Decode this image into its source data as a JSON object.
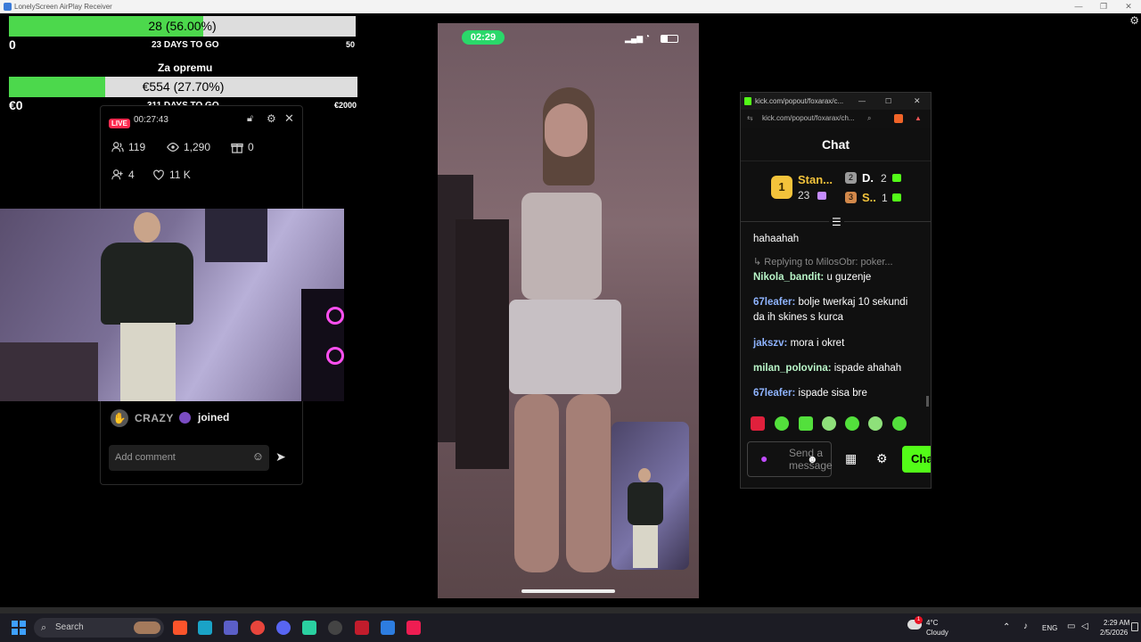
{
  "window": {
    "title": "LonelyScreen AirPlay Receiver",
    "controls": [
      "—",
      "❐",
      "✕"
    ]
  },
  "goal1": {
    "label": "28 (56.00%)",
    "percent": 56.0,
    "min": "0",
    "max": "50",
    "days": "23 DAYS TO GO"
  },
  "goal2": {
    "title": "Za opremu",
    "label": "€554 (27.70%)",
    "percent": 27.7,
    "min": "€0",
    "max": "€2000",
    "days": "311 DAYS TO GO"
  },
  "stream": {
    "live": "LIVE",
    "timer": "00:27:43",
    "viewers": "119",
    "views": "1,290",
    "gifts": "0",
    "follows": "4",
    "likes": "11 K",
    "join_user": "CRAZY",
    "join_text": "joined",
    "comment_placeholder": "Add comment"
  },
  "phone": {
    "time": "02:29"
  },
  "chat": {
    "window_title": "kick.com/popout/foxarax/c...",
    "url": "kick.com/popout/foxarax/ch...",
    "header": "Chat",
    "leaderboard": {
      "first_name": "Stan...",
      "first_count": "23",
      "second_name": "D.",
      "second_count": "2",
      "third_name": "S..",
      "third_count": "1",
      "rank1": "1",
      "rank2": "2",
      "rank3": "3"
    },
    "messages": [
      {
        "user": "",
        "text": "hahaahah",
        "color": "#ffffff"
      },
      {
        "user": "",
        "text": "Replying to MilosObr: poker...",
        "color": "#888888"
      },
      {
        "user": "Nikola_bandit:",
        "text": "u guzenje",
        "color": "#b9f5c8"
      },
      {
        "user": "67leafer:",
        "text": "bolje twerkaj 10 sekundi da ih skines s kurca",
        "color": "#8fb4ff"
      },
      {
        "user": "jakszv:",
        "text": "mora i okret",
        "color": "#8fb4ff"
      },
      {
        "user": "milan_polovina:",
        "text": "ispade ahahah",
        "color": "#b9f5c8"
      },
      {
        "user": "67leafer:",
        "text": "ispade sisa bre",
        "color": "#8fb4ff"
      }
    ],
    "input_placeholder": "Send a message",
    "send_label": "Cha"
  },
  "taskbar": {
    "search_placeholder": "Search",
    "weather_temp": "4°C",
    "weather_desc": "Cloudy",
    "lang": "ENG",
    "time": "2:29 AM",
    "date": "2/5/2026",
    "notif_count": "1"
  }
}
